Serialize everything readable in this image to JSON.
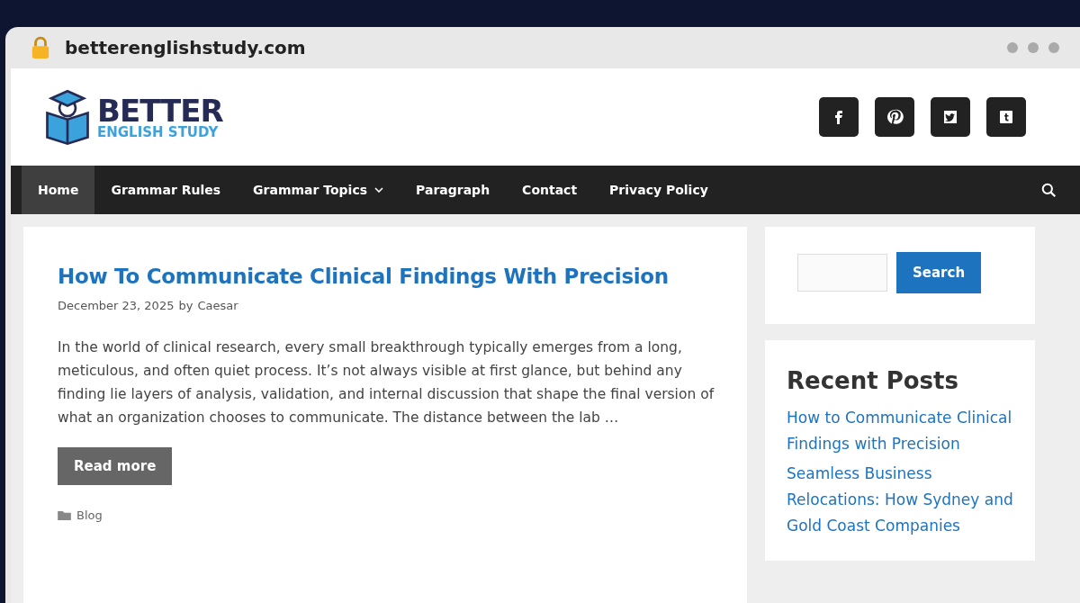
{
  "browser": {
    "url": "betterenglishstudy.com"
  },
  "site": {
    "logo_top": "BETTER",
    "logo_bottom": "ENGLISH STUDY",
    "social": [
      {
        "kind": "facebook"
      },
      {
        "kind": "pinterest"
      },
      {
        "kind": "twitter"
      },
      {
        "kind": "tumblr"
      }
    ]
  },
  "nav": {
    "items": [
      {
        "label": "Home",
        "selected": true,
        "dropdown": false
      },
      {
        "label": "Grammar Rules",
        "selected": false,
        "dropdown": false
      },
      {
        "label": "Grammar Topics",
        "selected": false,
        "dropdown": true
      },
      {
        "label": "Paragraph",
        "selected": false,
        "dropdown": false
      },
      {
        "label": "Contact",
        "selected": false,
        "dropdown": false
      },
      {
        "label": "Privacy Policy",
        "selected": false,
        "dropdown": false
      }
    ]
  },
  "post": {
    "title": "How To Communicate Clinical Findings With Precision",
    "date": "December 23, 2025",
    "by": "by",
    "author": "Caesar",
    "excerpt": "In the world of clinical research, every small breakthrough typically emerges from a long, meticulous, and often quiet process. It’s not always visible at first glance, but behind any finding lie layers of analysis, validation, and internal discussion that shape the final version of what an organization chooses to communicate. The distance between the lab …",
    "read_more": "Read more",
    "category": "Blog"
  },
  "sidebar": {
    "search_button": "Search",
    "recent_title": "Recent Posts",
    "recent_posts": [
      "How to Communicate Clinical Findings with Precision",
      "Seamless Business Relocations: How Sydney and Gold Coast Companies"
    ]
  }
}
